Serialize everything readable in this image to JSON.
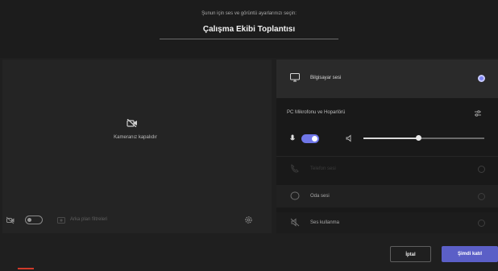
{
  "header": {
    "subtitle": "Şunun için ses ve görüntü ayarlarınızı seçin:",
    "meeting_title": "Çalışma Ekibi Toplantısı"
  },
  "preview": {
    "camera_off_label": "Kameranız kapalıdır",
    "camera_on": false,
    "background_filters_label": "Arka plan filtreleri"
  },
  "audio": {
    "computer_audio_label": "Bilgisayar sesi",
    "computer_audio_selected": true,
    "mic_speaker_heading": "PC Mikrofonu ve Hoparlörü",
    "mic_on": true,
    "speaker_volume": 0.45,
    "phone_audio_label": "Telefon sesi",
    "room_audio_label": "Oda sesi",
    "no_audio_label": "Ses kullanma"
  },
  "footer": {
    "cancel_label": "İptal",
    "join_label": "Şimdi katıl"
  },
  "colors": {
    "accent": "#5b5fc7",
    "toggle_on": "#6f76e8",
    "background": "#1f1f1f",
    "panel": "#2a2a2a"
  },
  "icons": [
    "camera-off-icon",
    "camera-toggle-icon",
    "background-filters-icon",
    "settings-icon",
    "computer-audio-icon",
    "devices-settings-icon",
    "microphone-icon",
    "speaker-icon",
    "phone-icon",
    "room-audio-icon",
    "no-audio-icon"
  ]
}
